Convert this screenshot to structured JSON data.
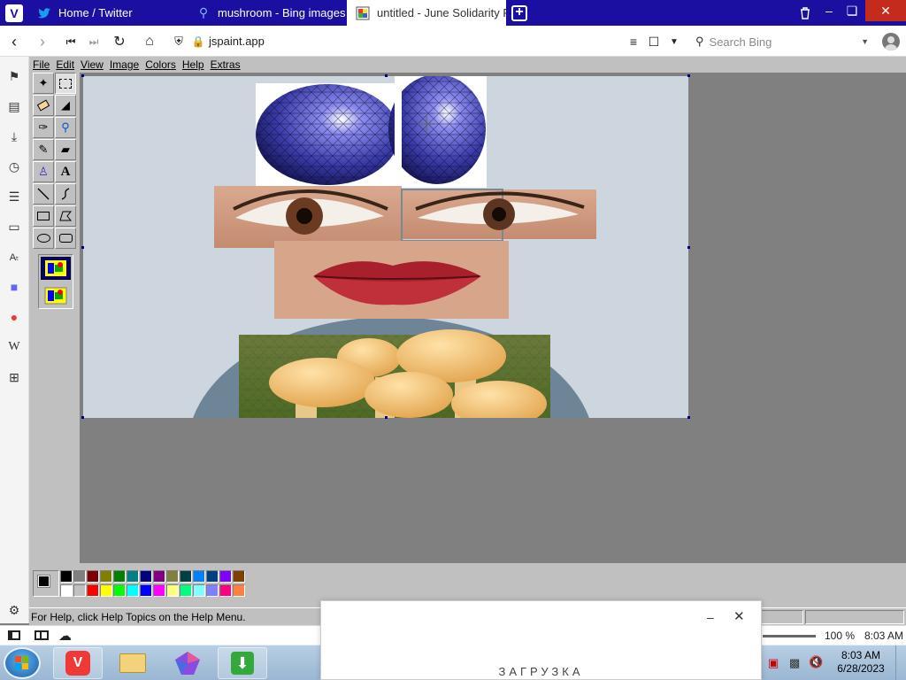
{
  "browser": {
    "tabs": [
      {
        "title": "Home / Twitter",
        "icon": "twitter-icon"
      },
      {
        "title": "mushroom - Bing images",
        "icon": "bing-search-icon"
      },
      {
        "title": "untitled - June Solidarity Pa",
        "icon": "paint-icon"
      }
    ],
    "url": "jspaint.app",
    "search_placeholder": "Search Bing"
  },
  "paint": {
    "menu": [
      "File",
      "Edit",
      "View",
      "Image",
      "Colors",
      "Help",
      "Extras"
    ],
    "status_text": "For Help, click Help Topics on the Help Menu.",
    "palette": {
      "foreground": "#000000",
      "background": "#ffffff",
      "row1": [
        "#000000",
        "#808080",
        "#800000",
        "#808000",
        "#008000",
        "#008080",
        "#000080",
        "#800080",
        "#808040",
        "#004040",
        "#0080ff",
        "#004080",
        "#8000ff",
        "#804000"
      ],
      "row2": [
        "#ffffff",
        "#c0c0c0",
        "#ff0000",
        "#ffff00",
        "#00ff00",
        "#00ffff",
        "#0000ff",
        "#ff00ff",
        "#ffff80",
        "#00ff80",
        "#80ffff",
        "#8080ff",
        "#ff0080",
        "#ff8040"
      ]
    }
  },
  "vivaldi_status": {
    "zoom": "100 %",
    "time": "8:03 AM"
  },
  "taskbar": {
    "clock_time": "8:03 AM",
    "clock_date": "6/28/2023"
  },
  "dialog": {
    "loading_text": "ЗАГРУЗКА"
  }
}
